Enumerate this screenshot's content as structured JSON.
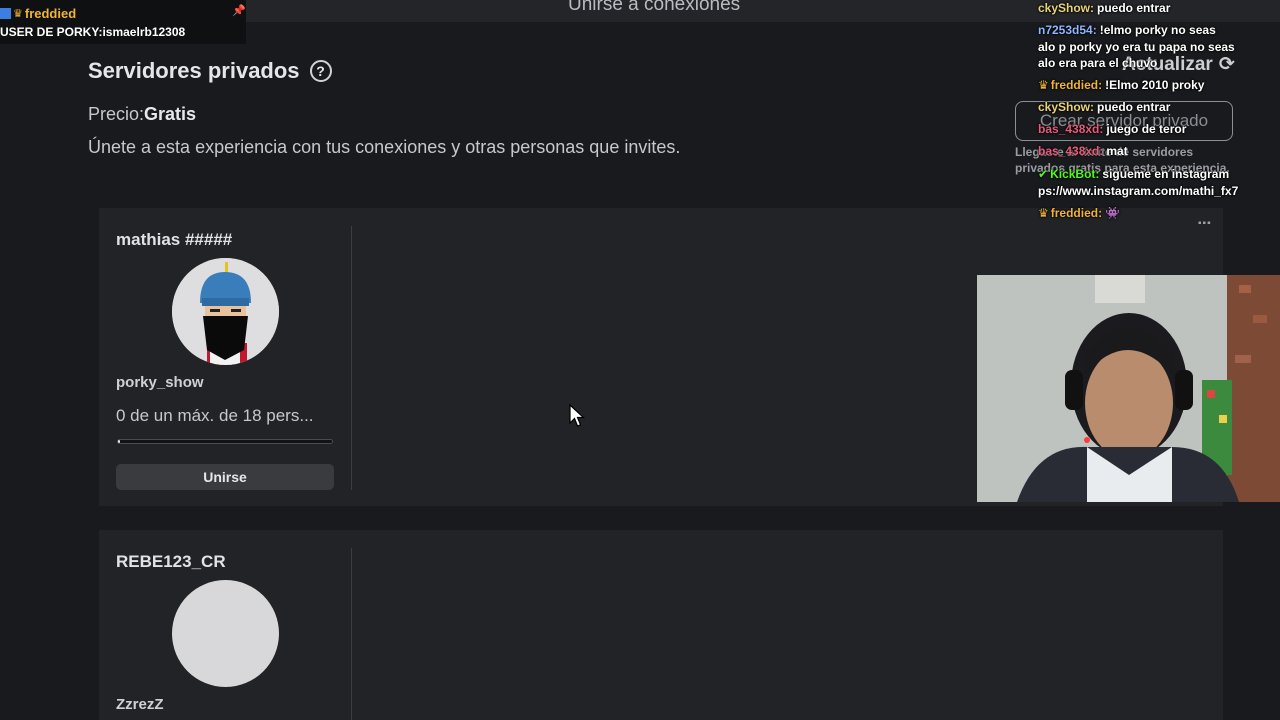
{
  "header": {
    "title": "Unirse a conexiones"
  },
  "stream_overlay": {
    "streamer_name": "freddied",
    "user_line": "USER DE PORKY:ismaelrb12308"
  },
  "section": {
    "title": "Servidores privados",
    "price_label": "Precio:",
    "price_value": "Gratis",
    "description": "Únete a esta experiencia con tus conexiones y otras personas que invites."
  },
  "actions": {
    "refresh_label": "Actualizar",
    "create_label": "Crear servidor privado",
    "limit_note": "Llegaste al límite de servidores privados gratis para esta experiencia."
  },
  "servers": [
    {
      "owner": "mathias #####",
      "user": "porky_show",
      "players": "0 de un máx. de 18 pers...",
      "progress": 0.01,
      "join_label": "Unirse"
    },
    {
      "owner": "REBE123_CR",
      "user": "ZzrezZ"
    }
  ],
  "chat": [
    {
      "user": "ckyShow:",
      "text": "puedo entrar",
      "color": "#e7d37a",
      "badge": ""
    },
    {
      "user": "n7253d54:",
      "text": "!elmo porky no seas",
      "color": "#8fb6ff",
      "badge": ""
    },
    {
      "user": "",
      "text": "alo p porky yo era tu papa no seas",
      "color": "#ffffff",
      "badge": ""
    },
    {
      "user": "",
      "text": "alo era para el chuvo",
      "color": "#ffffff",
      "badge": ""
    },
    {
      "user": "freddied:",
      "text": "!Elmo 2010 proky",
      "color": "#f0b33a",
      "badge": "crown"
    },
    {
      "user": "ckyShow:",
      "text": "puedo entrar",
      "color": "#e7d37a",
      "badge": ""
    },
    {
      "user": "bas_438xd:",
      "text": "juego de teror",
      "color": "#e85a7a",
      "badge": ""
    },
    {
      "user": "bas_438xd:",
      "text": "mat",
      "color": "#e85a7a",
      "badge": ""
    },
    {
      "user": "KickBot:",
      "text": "sigueme en instagram",
      "color": "#53fc18",
      "badge": "kick"
    },
    {
      "user": "",
      "text": "ps://www.instagram.com/mathi_fx7",
      "color": "#ffffff",
      "badge": ""
    },
    {
      "user": "freddied:",
      "text": "👾",
      "color": "#f0b33a",
      "badge": "crown"
    }
  ],
  "chat_more": "▪▪▪",
  "colors": {
    "background": "#191a1d",
    "card": "#222326",
    "accent_streamer": "#f0b33a"
  }
}
